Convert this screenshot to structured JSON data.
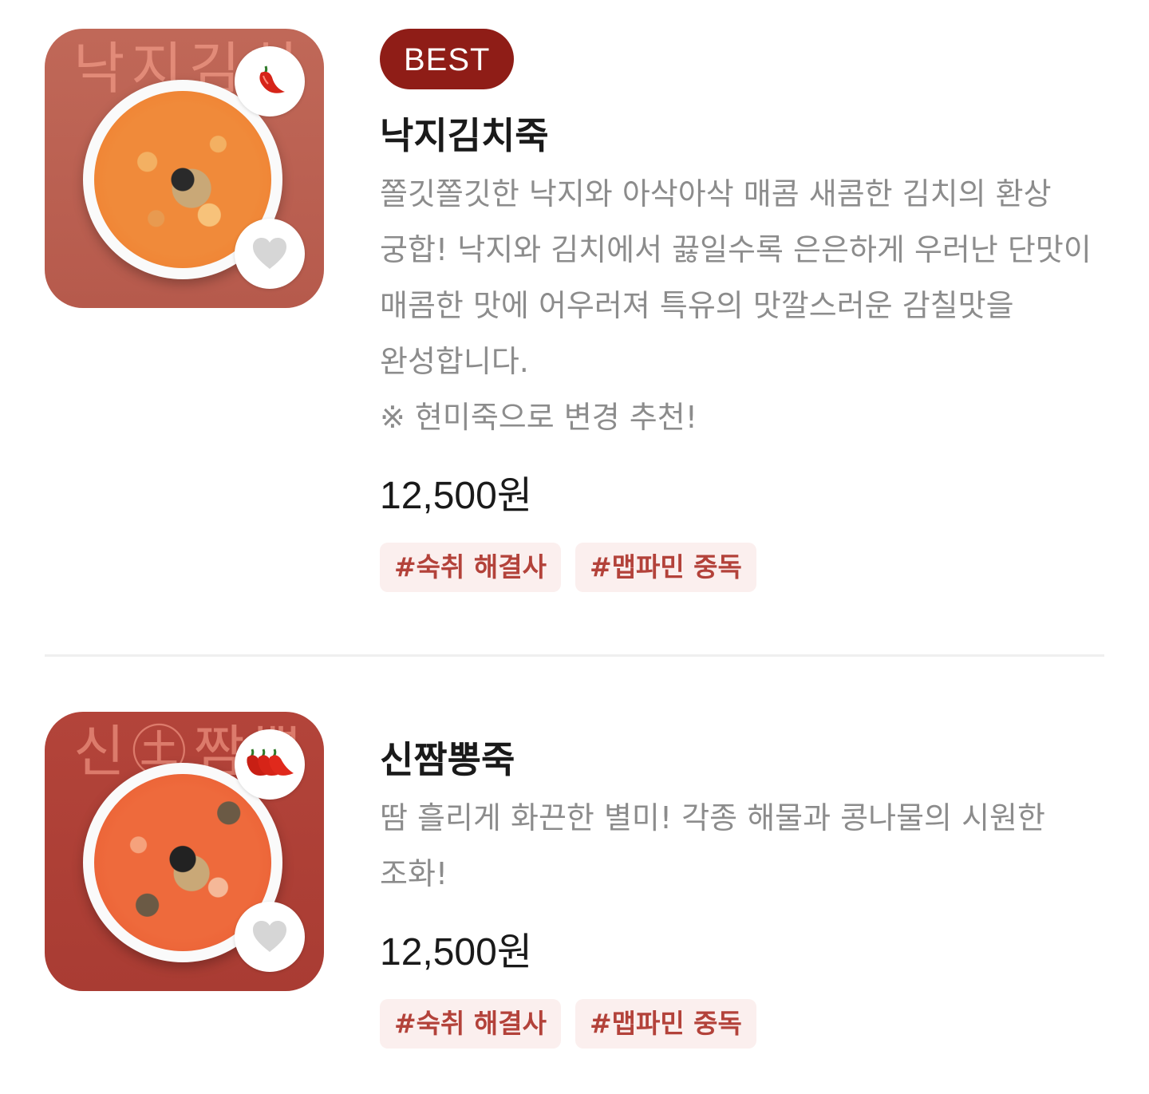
{
  "items": [
    {
      "badge": "BEST",
      "thumb_text": "낙지김치",
      "spice_icon": "single-chili-pepper",
      "title": "낙지김치죽",
      "description": "쫄깃쫄깃한 낙지와 아삭아삭 매콤 새콤한 김치의 환상 궁합! 낙지와 김치에서 끓일수록 은은하게 우러난 단맛이 매콤한 맛에 어우러져 특유의 맛깔스러운 감칠맛을 완성합니다.",
      "note": "※ 현미죽으로 변경 추천!",
      "price": "12,500원",
      "tags": [
        "#숙취 해결사",
        "#맵파민 중독"
      ]
    },
    {
      "badge": "",
      "thumb_text": "신㊏짬뽕",
      "spice_icon": "triple-chili-pepper",
      "title": "신짬뽕죽",
      "description": "땀 흘리게 화끈한 별미! 각종 해물과 콩나물의 시원한 조화!",
      "note": "",
      "price": "12,500원",
      "tags": [
        "#숙취 해결사",
        "#맵파민 중독"
      ]
    }
  ],
  "colors": {
    "best_badge": "#8f1d17",
    "tag_text": "#b3423a",
    "tag_bg": "#fbefee",
    "description": "#8c8c8c",
    "heart": "#d6d6d6"
  }
}
